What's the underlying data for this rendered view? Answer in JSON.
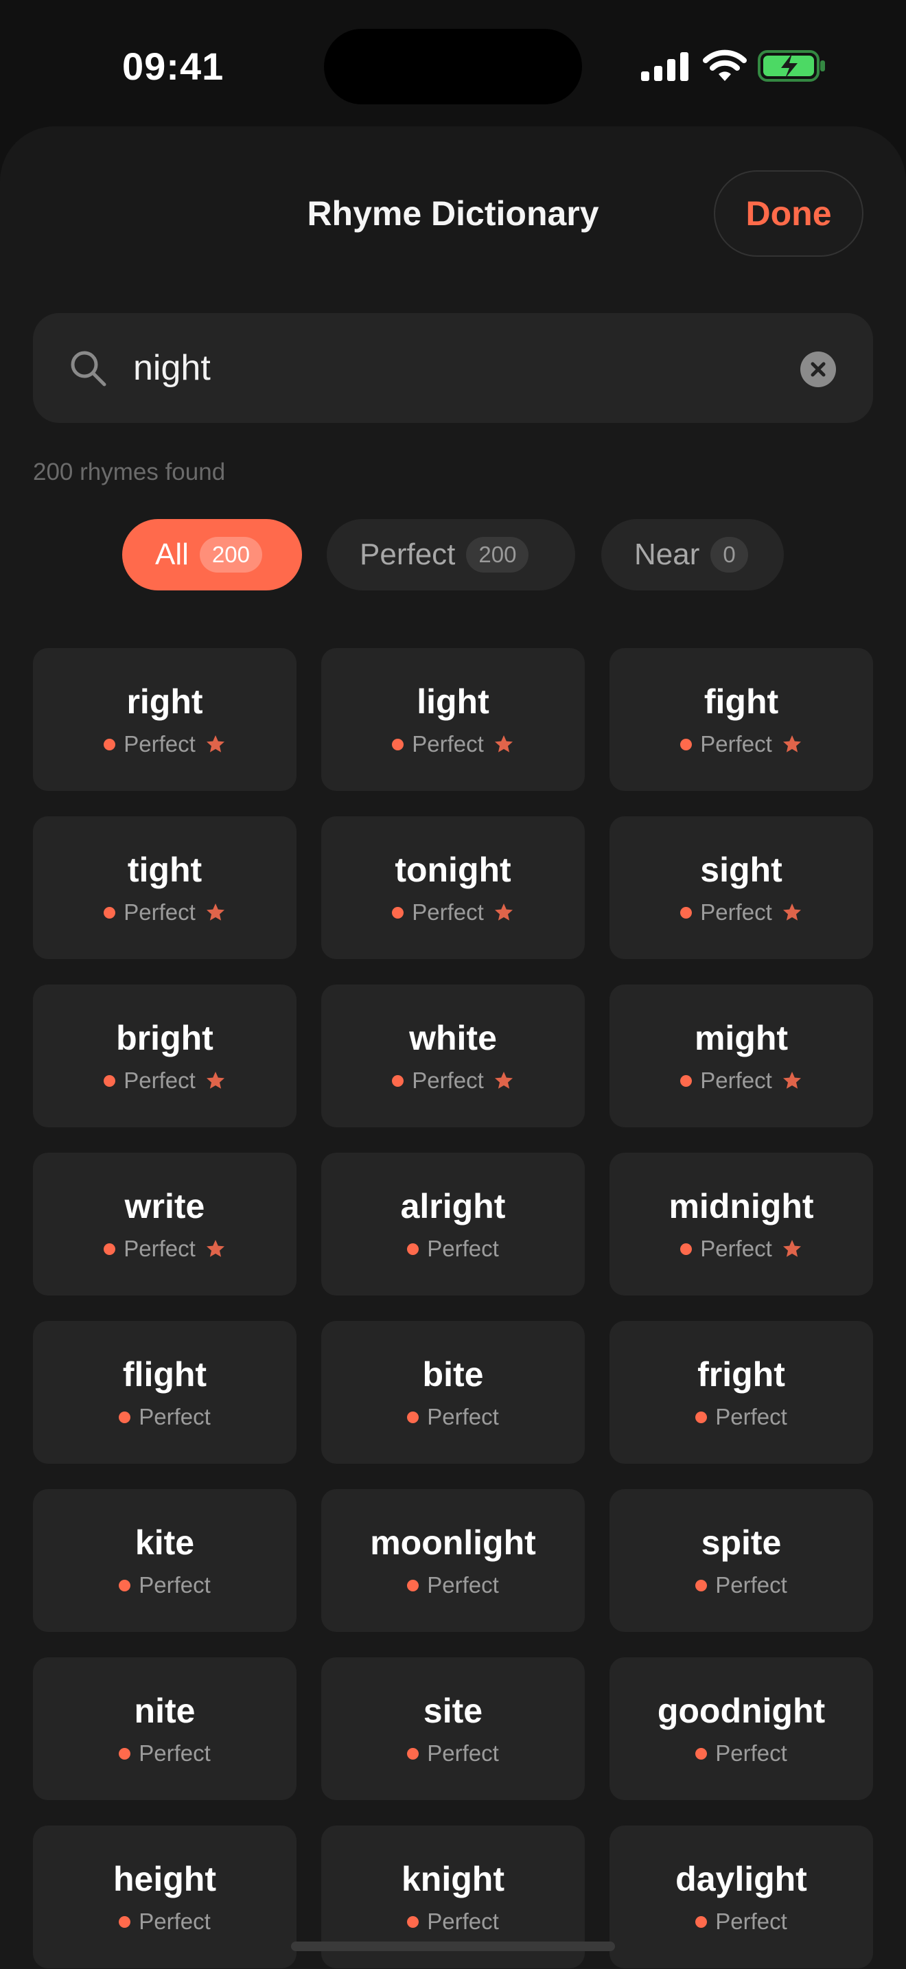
{
  "status_bar": {
    "time": "09:41",
    "icons": [
      "cellular-signal-icon",
      "wifi-icon",
      "battery-charging-icon"
    ],
    "battery_color": "#4cd964"
  },
  "header": {
    "title": "Rhyme Dictionary",
    "done_label": "Done"
  },
  "search": {
    "query": "night",
    "icon": "search-icon",
    "clear_icon": "clear-icon"
  },
  "result_count": "200 rhymes found",
  "filters": [
    {
      "label": "All",
      "count": "200",
      "selected": true
    },
    {
      "label": "Perfect",
      "count": "200",
      "selected": false
    },
    {
      "label": "Near",
      "count": "0",
      "selected": false
    }
  ],
  "colors": {
    "accent": "#ff6a4c",
    "background": "#111111",
    "sheet": "#191919",
    "card": "#252525"
  },
  "rhymes": [
    {
      "word": "right",
      "type": "Perfect",
      "starred": true
    },
    {
      "word": "light",
      "type": "Perfect",
      "starred": true
    },
    {
      "word": "fight",
      "type": "Perfect",
      "starred": true
    },
    {
      "word": "tight",
      "type": "Perfect",
      "starred": true
    },
    {
      "word": "tonight",
      "type": "Perfect",
      "starred": true
    },
    {
      "word": "sight",
      "type": "Perfect",
      "starred": true
    },
    {
      "word": "bright",
      "type": "Perfect",
      "starred": true
    },
    {
      "word": "white",
      "type": "Perfect",
      "starred": true
    },
    {
      "word": "might",
      "type": "Perfect",
      "starred": true
    },
    {
      "word": "write",
      "type": "Perfect",
      "starred": true
    },
    {
      "word": "alright",
      "type": "Perfect",
      "starred": false
    },
    {
      "word": "midnight",
      "type": "Perfect",
      "starred": true
    },
    {
      "word": "flight",
      "type": "Perfect",
      "starred": false
    },
    {
      "word": "bite",
      "type": "Perfect",
      "starred": false
    },
    {
      "word": "fright",
      "type": "Perfect",
      "starred": false
    },
    {
      "word": "kite",
      "type": "Perfect",
      "starred": false
    },
    {
      "word": "moonlight",
      "type": "Perfect",
      "starred": false
    },
    {
      "word": "spite",
      "type": "Perfect",
      "starred": false
    },
    {
      "word": "nite",
      "type": "Perfect",
      "starred": false
    },
    {
      "word": "site",
      "type": "Perfect",
      "starred": false
    },
    {
      "word": "goodnight",
      "type": "Perfect",
      "starred": false
    },
    {
      "word": "height",
      "type": "Perfect",
      "starred": false
    },
    {
      "word": "knight",
      "type": "Perfect",
      "starred": false
    },
    {
      "word": "daylight",
      "type": "Perfect",
      "starred": false
    }
  ]
}
